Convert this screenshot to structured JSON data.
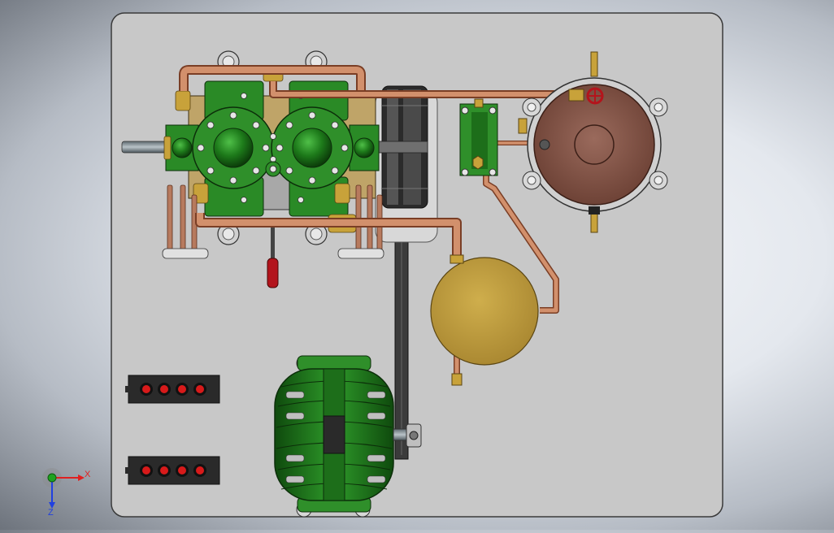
{
  "triad": {
    "x_label": "X",
    "z_label": "Z",
    "x_color": "#e02020",
    "y_color": "#1fa21f",
    "z_color": "#2040e0"
  },
  "colors": {
    "panel": "#c9c9c9",
    "panel_edge": "#3a3a3a",
    "green": "#2f8f2a",
    "green_dark": "#0f3f0c",
    "copper": "#c9825f",
    "copper_dark": "#7a3e25",
    "brass": "#c8a23a",
    "tank": "#b8963c",
    "receiver": "#86574b",
    "indicator_red": "#d81a1a",
    "belt": "#3a3a3a"
  },
  "model": {
    "components": [
      "base-panel",
      "compressor",
      "flywheel",
      "receiver-tank",
      "accumulator-tank",
      "oil-separator",
      "motor",
      "indicator-panel-top",
      "indicator-panel-bottom"
    ]
  }
}
